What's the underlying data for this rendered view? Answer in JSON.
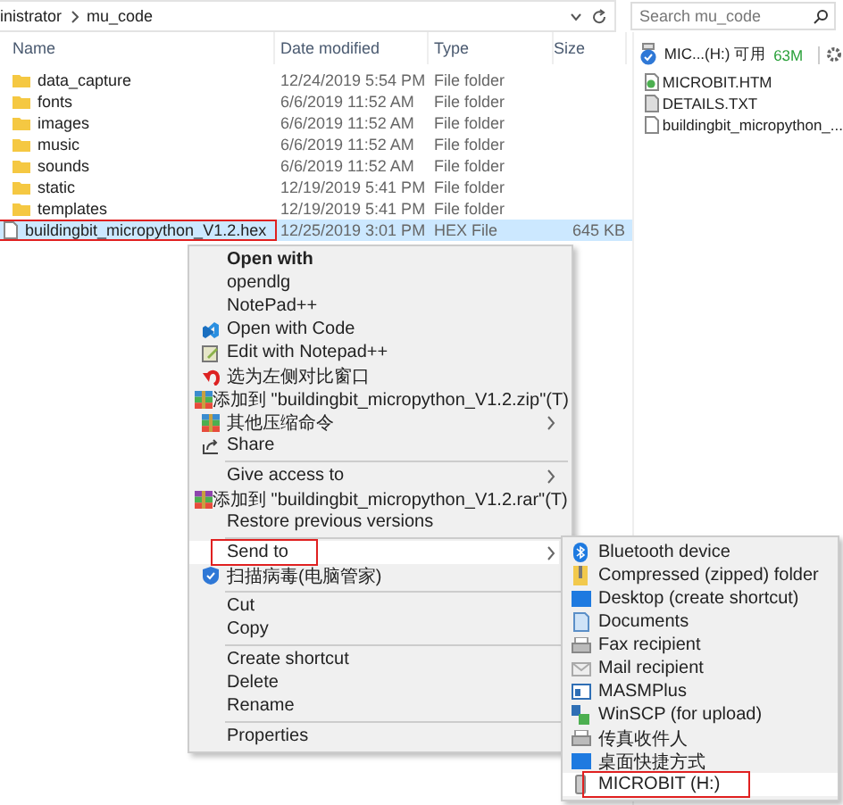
{
  "address_bar": {
    "path": [
      "inistrator",
      "mu_code"
    ]
  },
  "search": {
    "placeholder": "Search mu_code"
  },
  "table": {
    "columns": [
      "Name",
      "Date modified",
      "Type",
      "Size"
    ],
    "rows": [
      {
        "name": "data_capture",
        "date": "12/24/2019 5:54 PM",
        "type": "File folder",
        "size": "",
        "kind": "folder",
        "selected": false,
        "annotated": false
      },
      {
        "name": "fonts",
        "date": "6/6/2019 11:52 AM",
        "type": "File folder",
        "size": "",
        "kind": "folder",
        "selected": false,
        "annotated": false
      },
      {
        "name": "images",
        "date": "6/6/2019 11:52 AM",
        "type": "File folder",
        "size": "",
        "kind": "folder",
        "selected": false,
        "annotated": false
      },
      {
        "name": "music",
        "date": "6/6/2019 11:52 AM",
        "type": "File folder",
        "size": "",
        "kind": "folder",
        "selected": false,
        "annotated": false
      },
      {
        "name": "sounds",
        "date": "6/6/2019 11:52 AM",
        "type": "File folder",
        "size": "",
        "kind": "folder",
        "selected": false,
        "annotated": false
      },
      {
        "name": "static",
        "date": "12/19/2019 5:41 PM",
        "type": "File folder",
        "size": "",
        "kind": "folder",
        "selected": false,
        "annotated": false
      },
      {
        "name": "templates",
        "date": "12/19/2019 5:41 PM",
        "type": "File folder",
        "size": "",
        "kind": "folder",
        "selected": false,
        "annotated": false
      },
      {
        "name": "buildingbit_micropython_V1.2.hex",
        "date": "12/25/2019 3:01 PM",
        "type": "HEX File",
        "size": "645 KB",
        "kind": "file",
        "selected": true,
        "annotated": true
      }
    ]
  },
  "preview_pane": {
    "drive": "MIC...(H:) 可用",
    "free": "63M",
    "files": [
      "MICROBIT.HTM",
      "DETAILS.TXT",
      "buildingbit_micropython_..."
    ]
  },
  "context_menu": {
    "items": [
      {
        "kind": "item",
        "label": "Open with",
        "bold": true,
        "submenu": false,
        "selected": false,
        "annotated": false
      },
      {
        "kind": "item",
        "label": "opendlg",
        "bold": false,
        "submenu": false,
        "selected": false,
        "annotated": false
      },
      {
        "kind": "item",
        "label": "NotePad++",
        "bold": false,
        "submenu": false,
        "selected": false,
        "annotated": false
      },
      {
        "kind": "item",
        "label": "Open with Code",
        "bold": false,
        "submenu": false,
        "selected": false,
        "annotated": false
      },
      {
        "kind": "item",
        "label": "Edit with Notepad++",
        "bold": false,
        "submenu": false,
        "selected": false,
        "annotated": false
      },
      {
        "kind": "item",
        "label": "选为左侧对比窗口",
        "bold": false,
        "submenu": false,
        "selected": false,
        "annotated": false
      },
      {
        "kind": "item",
        "label": "添加到 \"buildingbit_micropython_V1.2.zip\"(T)",
        "bold": false,
        "submenu": false,
        "selected": false,
        "annotated": false
      },
      {
        "kind": "item",
        "label": "其他压缩命令",
        "bold": false,
        "submenu": true,
        "selected": false,
        "annotated": false
      },
      {
        "kind": "item",
        "label": "Share",
        "bold": false,
        "submenu": false,
        "selected": false,
        "annotated": false
      },
      {
        "kind": "separator"
      },
      {
        "kind": "item",
        "label": "Give access to",
        "bold": false,
        "submenu": true,
        "selected": false,
        "annotated": false
      },
      {
        "kind": "item",
        "label": "添加到 \"buildingbit_micropython_V1.2.rar\"(T)",
        "bold": false,
        "submenu": false,
        "selected": false,
        "annotated": false
      },
      {
        "kind": "item",
        "label": "Restore previous versions",
        "bold": false,
        "submenu": false,
        "selected": false,
        "annotated": false
      },
      {
        "kind": "separator"
      },
      {
        "kind": "item",
        "label": "Send to",
        "bold": false,
        "submenu": true,
        "selected": true,
        "annotated": true
      },
      {
        "kind": "item",
        "label": "扫描病毒(电脑管家)",
        "bold": false,
        "submenu": false,
        "selected": false,
        "annotated": false
      },
      {
        "kind": "separator"
      },
      {
        "kind": "item",
        "label": "Cut",
        "bold": false,
        "submenu": false,
        "selected": false,
        "annotated": false
      },
      {
        "kind": "item",
        "label": "Copy",
        "bold": false,
        "submenu": false,
        "selected": false,
        "annotated": false
      },
      {
        "kind": "separator"
      },
      {
        "kind": "item",
        "label": "Create shortcut",
        "bold": false,
        "submenu": false,
        "selected": false,
        "annotated": false
      },
      {
        "kind": "item",
        "label": "Delete",
        "bold": false,
        "submenu": false,
        "selected": false,
        "annotated": false
      },
      {
        "kind": "item",
        "label": "Rename",
        "bold": false,
        "submenu": false,
        "selected": false,
        "annotated": false
      },
      {
        "kind": "separator"
      },
      {
        "kind": "item",
        "label": "Properties",
        "bold": false,
        "submenu": false,
        "selected": false,
        "annotated": false
      }
    ]
  },
  "send_to_menu": {
    "items": [
      {
        "label": "Bluetooth device",
        "selected": false,
        "annotated": false
      },
      {
        "label": "Compressed (zipped) folder",
        "selected": false,
        "annotated": false
      },
      {
        "label": "Desktop (create shortcut)",
        "selected": false,
        "annotated": false
      },
      {
        "label": "Documents",
        "selected": false,
        "annotated": false
      },
      {
        "label": "Fax recipient",
        "selected": false,
        "annotated": false
      },
      {
        "label": "Mail recipient",
        "selected": false,
        "annotated": false
      },
      {
        "label": "MASMPlus",
        "selected": false,
        "annotated": false
      },
      {
        "label": "WinSCP (for upload)",
        "selected": false,
        "annotated": false
      },
      {
        "label": "传真收件人",
        "selected": false,
        "annotated": false
      },
      {
        "label": "桌面快捷方式",
        "selected": false,
        "annotated": false
      },
      {
        "label": "MICROBIT (H:)",
        "selected": true,
        "annotated": true
      }
    ]
  }
}
